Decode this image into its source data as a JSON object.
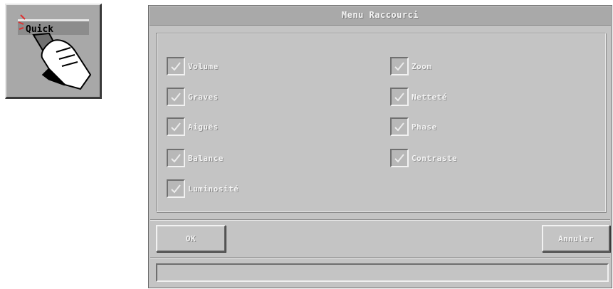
{
  "quick_icon": {
    "label": "Quick"
  },
  "dialog": {
    "title": "Menu Raccourci",
    "options_left": [
      {
        "label": "Volume",
        "checked": true
      },
      {
        "label": "Graves",
        "checked": true
      },
      {
        "label": "Aiguës",
        "checked": true
      },
      {
        "label": "Balance",
        "checked": true
      },
      {
        "label": "Luminosité",
        "checked": true
      }
    ],
    "options_right": [
      {
        "label": "Zoom",
        "checked": true
      },
      {
        "label": "Netteté",
        "checked": true
      },
      {
        "label": "Phase",
        "checked": true
      },
      {
        "label": "Contraste",
        "checked": true
      }
    ],
    "ok_label": "OK",
    "cancel_label": "Annuler",
    "status_text": ""
  }
}
